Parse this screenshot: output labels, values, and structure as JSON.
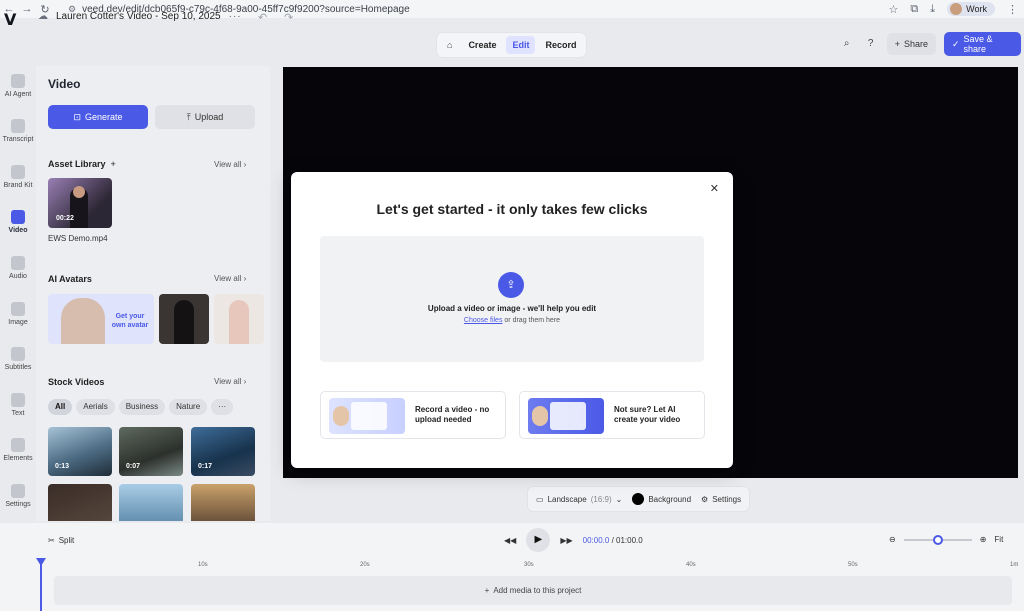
{
  "browser": {
    "url": "veed.dev/edit/dcb065f9-c79c-4f68-9a00-45ff7c9f9200?source=Homepage",
    "profile": "Work"
  },
  "header": {
    "logo": "V",
    "project_title": "Lauren Cotter's Video - Sep 10, 2025",
    "modes": [
      "Create",
      "Edit",
      "Record"
    ],
    "share_label": "Share",
    "save_label": "Save & share"
  },
  "rail": {
    "items": [
      {
        "label": "AI Agent"
      },
      {
        "label": "Transcript"
      },
      {
        "label": "Brand Kit"
      },
      {
        "label": "Video"
      },
      {
        "label": "Audio"
      },
      {
        "label": "Image"
      },
      {
        "label": "Subtitles"
      },
      {
        "label": "Text"
      },
      {
        "label": "Elements"
      },
      {
        "label": "Settings"
      }
    ]
  },
  "panel": {
    "title": "Video",
    "generate_label": "Generate",
    "upload_label": "Upload",
    "asset_library": {
      "title": "Asset Library",
      "view_all": "View all",
      "asset": {
        "duration": "00:22",
        "name": "EWS Demo.mp4"
      }
    },
    "ai_avatars": {
      "title": "AI Avatars",
      "view_all": "View all",
      "card_text": "Get your own avatar"
    },
    "stock_videos": {
      "title": "Stock Videos",
      "view_all": "View all",
      "chips": [
        "All",
        "Aerials",
        "Business",
        "Nature",
        "···"
      ],
      "durations": [
        "0:13",
        "0:07",
        "0:17"
      ]
    }
  },
  "canvas_controls": {
    "aspect_label": "Landscape",
    "aspect_ratio": "(16:9)",
    "background_label": "Background",
    "settings_label": "Settings"
  },
  "timeline": {
    "split_label": "Split",
    "current_time": "00:00.0",
    "separator": "/",
    "total_time": "01:00.0",
    "fit_label": "Fit",
    "zoom_level": 0.5,
    "ticks": [
      "10s",
      "20s",
      "30s",
      "40s",
      "50s",
      "1m"
    ],
    "add_media": "Add media to this project"
  },
  "modal": {
    "title": "Let's get started - it only takes few clicks",
    "drop_text": "Upload a video or image - we'll help you edit",
    "choose_files": "Choose files",
    "drag_text": "or drag them here",
    "option1": "Record a video - no upload needed",
    "option2": "Not sure? Let AI create your video"
  },
  "colors": {
    "accent": "#4b5ae6",
    "canvas": "#05050a"
  }
}
